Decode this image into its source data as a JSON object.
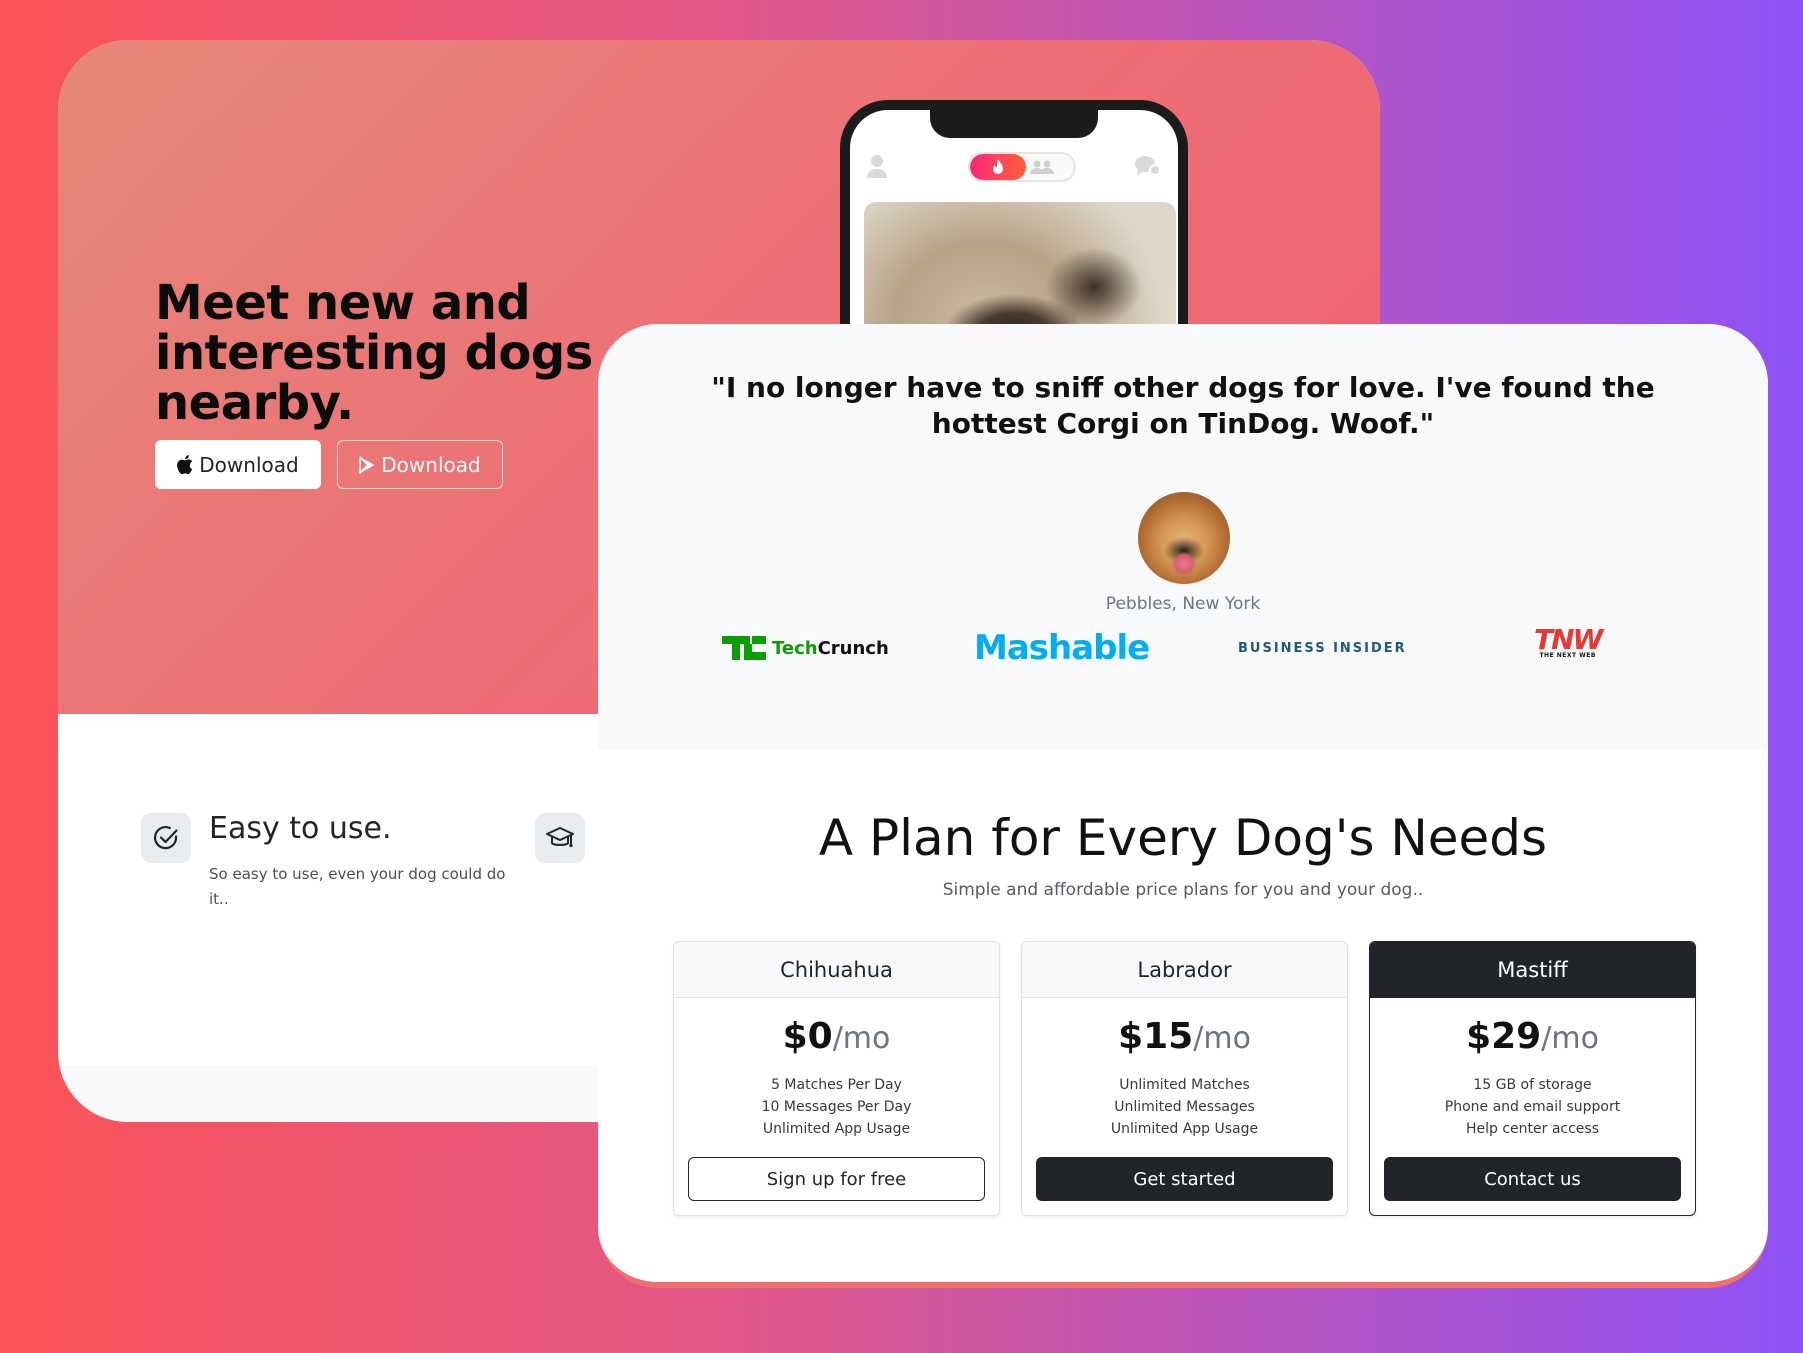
{
  "hero": {
    "title": "Meet new and interesting dogs nearby.",
    "apple_download_label": "Download",
    "play_download_label": "Download"
  },
  "features": [
    {
      "title": "Easy to use.",
      "description": "So easy to use, even your dog could do it..",
      "icon": "check-circle-icon"
    },
    {
      "icon": "graduation-cap-icon"
    }
  ],
  "testimonial": {
    "quote": "\"I no longer have to sniff other dogs for love. I've found the hottest Corgi on TinDog. Woof.\"",
    "caption": "Pebbles, New York"
  },
  "press": {
    "techcrunch_tech": "Tech",
    "techcrunch_crunch": "Crunch",
    "mashable": "Mashable",
    "business_insider": "BUSINESS INSIDER",
    "tnw": "TNW",
    "tnw_small": "THE NEXT WEB"
  },
  "pricing": {
    "title": "A Plan for Every Dog's Needs",
    "subtitle": "Simple and affordable price plans for you and your dog..",
    "per_label": "/mo",
    "plans": [
      {
        "name": "Chihuahua",
        "price": "$0",
        "features": [
          "5 Matches Per Day",
          "10 Messages Per Day",
          "Unlimited App Usage"
        ],
        "button": "Sign up for free"
      },
      {
        "name": "Labrador",
        "price": "$15",
        "features": [
          "Unlimited Matches",
          "Unlimited Messages",
          "Unlimited App Usage"
        ],
        "button": "Get started"
      },
      {
        "name": "Mastiff",
        "price": "$29",
        "features": [
          "15 GB of storage",
          "Phone and email support",
          "Help center access"
        ],
        "button": "Contact us"
      }
    ]
  },
  "colors": {
    "accent_dark": "#212529",
    "techcrunch_green": "#0a9e01",
    "mashable_blue": "#00aeef",
    "tnw_red": "#e53935",
    "tinder_gradient_start": "#fd267a",
    "tinder_gradient_end": "#ff6036"
  }
}
